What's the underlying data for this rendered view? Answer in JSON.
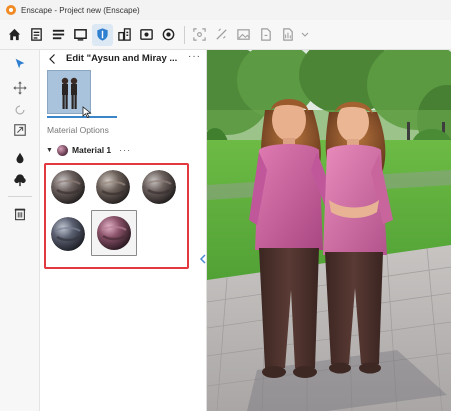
{
  "window": {
    "title": "Enscape - Project new (Enscape)"
  },
  "toolbar": {
    "icons": [
      "home-icon",
      "document-icon",
      "list-icon",
      "monitor-icon",
      "shield-icon",
      "buildings-icon",
      "asset-library-icon",
      "sun-icon",
      "capture-icon",
      "measure-icon",
      "image-icon",
      "export-icon",
      "chevron-down-icon",
      "render-icon",
      "chevron-down-icon"
    ]
  },
  "leftbar": {
    "icons": [
      "select-arrow-icon",
      "move-icon",
      "rotate-icon",
      "scale-icon",
      "drop-icon",
      "tree-icon",
      "trash-icon"
    ]
  },
  "panel": {
    "title": "Edit \"Aysun and Miray ...",
    "more": "···",
    "section_label": "Material Options",
    "material": {
      "name": "Material 1",
      "more": "···",
      "variant_count": 5,
      "selected_index": 4
    }
  },
  "colors": {
    "accent": "#3a86c8",
    "highlight": "#e2383f",
    "sweater": "#c65a95",
    "pants": "#4a2f2b",
    "grass": "#5fae3c",
    "pavement": "#b9b6b4"
  }
}
